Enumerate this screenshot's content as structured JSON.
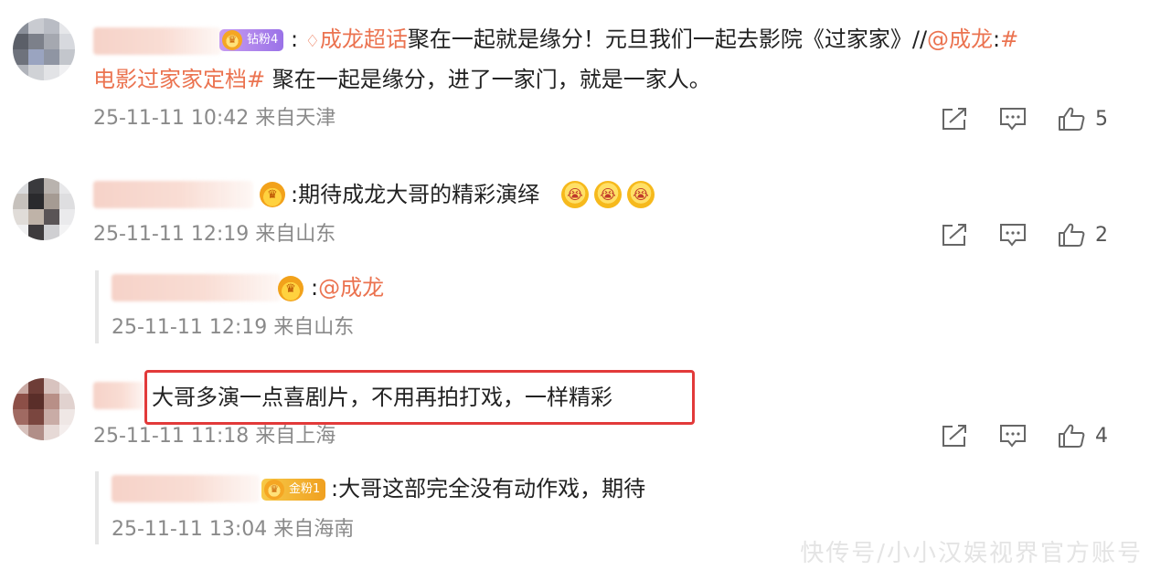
{
  "comments": [
    {
      "badge_label": "钻粉4",
      "prefix_colon": ":",
      "supertopic": "成龙超话",
      "text_line1": "聚在一起就是缘分！元旦我们一起去影院《过家家》//",
      "mention": "@成龙",
      "mention_colon": ":",
      "hashtag_start": "#",
      "hashtag": "电影过家家定档#",
      "text_line2": " 聚在一起是缘分，进了一家门，就是一家人。",
      "time": "25-11-11 10:42 来自天津",
      "likes": "5"
    },
    {
      "text": ":期待成龙大哥的精彩演绎",
      "time": "25-11-11 12:19 来自山东",
      "likes": "2",
      "reply": {
        "prefix_colon": ":",
        "mention": "@成龙",
        "time": "25-11-11 12:19 来自山东"
      }
    },
    {
      "text": "大哥多演一点喜剧片，不用再拍打戏，一样精彩",
      "time": "25-11-11 11:18 来自上海",
      "likes": "4",
      "reply": {
        "badge_label": "金粉1",
        "text": ":大哥这部完全没有动作戏，期待",
        "time": "25-11-11 13:04 来自海南"
      }
    }
  ],
  "icons": {
    "share": "share-icon",
    "comment": "comment-icon",
    "like": "thumbs-up-icon",
    "crown": "crown-emoji-icon",
    "face": "crying-face-emoji-icon"
  },
  "colors": {
    "link": "#eb7350",
    "time": "#8a8a8a",
    "highlight": "#e23a3a"
  },
  "watermark": "快传号/小小汉娱视界官方账号"
}
